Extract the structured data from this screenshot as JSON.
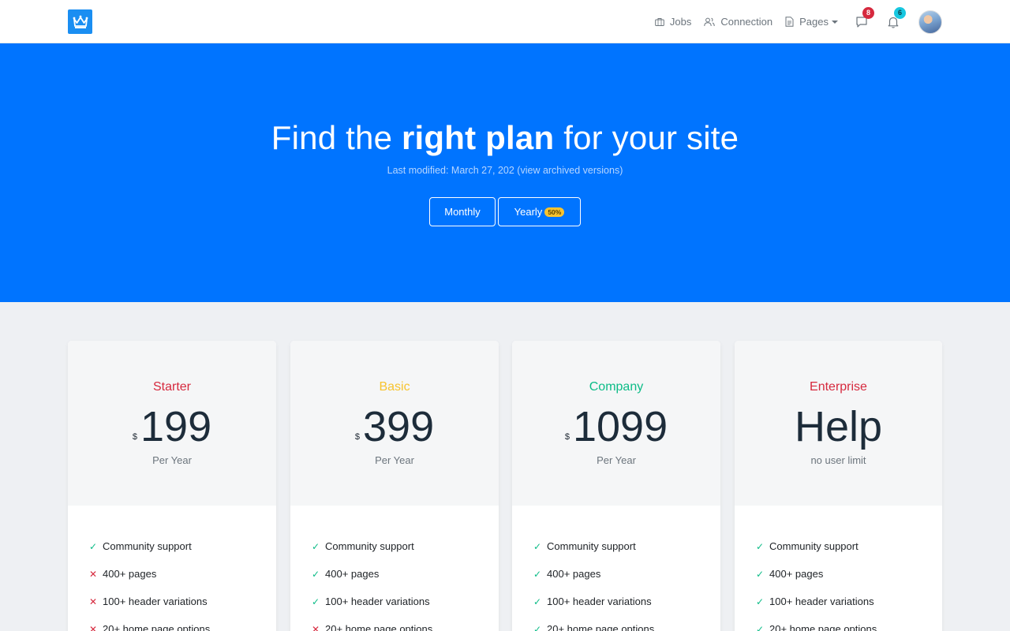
{
  "colors": {
    "brand": "#0074ff",
    "starter": "#d6293e",
    "basic": "#f7c32e",
    "company": "#0cbc87",
    "enterprise": "#d6293e",
    "check": "#0cbc87",
    "cross": "#d6293e"
  },
  "nav": {
    "logo_icon": "crown-icon",
    "links": [
      {
        "label": "Jobs",
        "icon": "briefcase-icon"
      },
      {
        "label": "Connection",
        "icon": "people-icon"
      },
      {
        "label": "Pages",
        "icon": "file-icon"
      }
    ],
    "messages_count": "8",
    "notifications_count": "6"
  },
  "hero": {
    "title_pre": "Find the ",
    "title_bold": "right plan",
    "title_post": " for your site",
    "subtitle": "Last modified: March 27, 202 (view archived versions)",
    "monthly_label": "Monthly",
    "yearly_label": "Yearly",
    "yearly_badge": "50%"
  },
  "plans": [
    {
      "name": "Starter",
      "currency": "$",
      "price": "199",
      "period": "Per Year",
      "features": [
        {
          "label": "Community support",
          "included": true
        },
        {
          "label": "400+ pages",
          "included": false
        },
        {
          "label": "100+ header variations",
          "included": false
        },
        {
          "label": "20+ home page options",
          "included": false
        }
      ]
    },
    {
      "name": "Basic",
      "currency": "$",
      "price": "399",
      "period": "Per Year",
      "features": [
        {
          "label": "Community support",
          "included": true
        },
        {
          "label": "400+ pages",
          "included": true
        },
        {
          "label": "100+ header variations",
          "included": true
        },
        {
          "label": "20+ home page options",
          "included": false
        }
      ]
    },
    {
      "name": "Company",
      "currency": "$",
      "price": "1099",
      "period": "Per Year",
      "features": [
        {
          "label": "Community support",
          "included": true
        },
        {
          "label": "400+ pages",
          "included": true
        },
        {
          "label": "100+ header variations",
          "included": true
        },
        {
          "label": "20+ home page options",
          "included": true
        }
      ]
    },
    {
      "name": "Enterprise",
      "currency": "",
      "price": "Help",
      "period": "no user limit",
      "features": [
        {
          "label": "Community support",
          "included": true
        },
        {
          "label": "400+ pages",
          "included": true
        },
        {
          "label": "100+ header variations",
          "included": true
        },
        {
          "label": "20+ home page options",
          "included": true
        }
      ]
    }
  ]
}
